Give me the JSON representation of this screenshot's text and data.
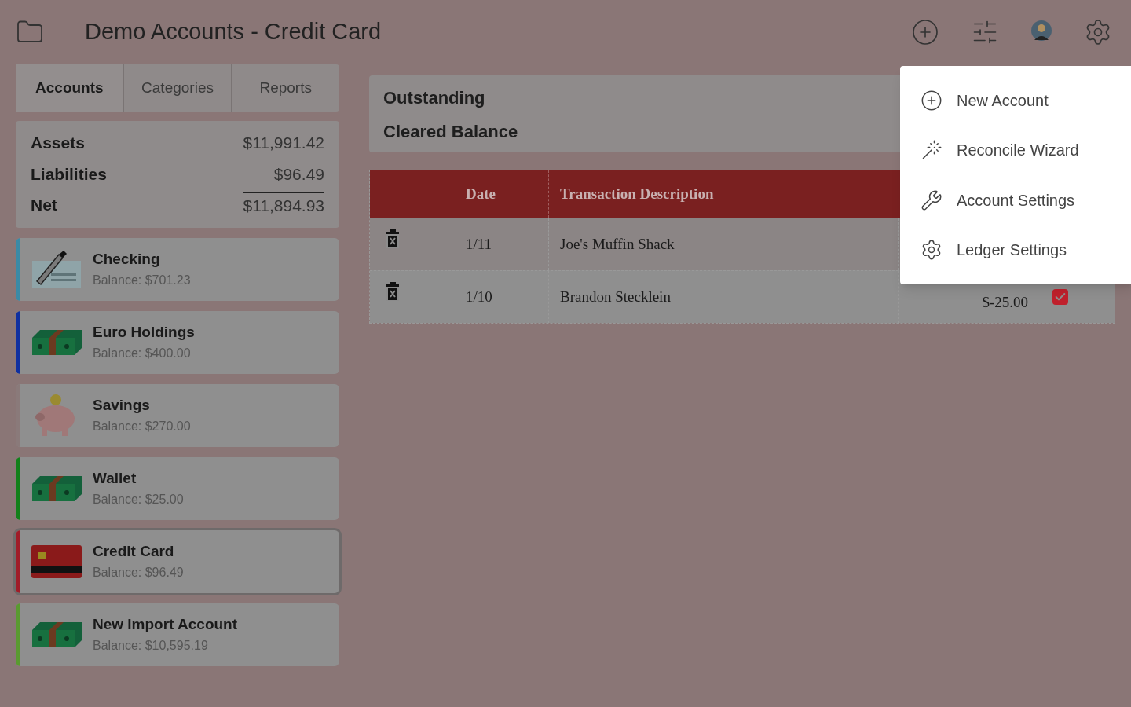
{
  "header": {
    "title": "Demo Accounts - Credit Card"
  },
  "tabs": [
    {
      "label": "Accounts",
      "selected": true
    },
    {
      "label": "Categories",
      "selected": false
    },
    {
      "label": "Reports",
      "selected": false
    }
  ],
  "summary": [
    {
      "kind": "line",
      "label": "Assets",
      "value": "$11,991.42"
    },
    {
      "kind": "line",
      "label": "Liabilities",
      "value": "$96.49"
    },
    {
      "kind": "total",
      "label": "Net",
      "value": "$11,894.93"
    }
  ],
  "accounts": [
    {
      "name": "Checking",
      "balance": "Balance: $701.23",
      "kind": "check",
      "color": "#3a8aa6",
      "selected": false
    },
    {
      "name": "Euro Holdings",
      "balance": "Balance: $400.00",
      "kind": "cash",
      "color": "#1030a0",
      "selected": false
    },
    {
      "name": "Savings",
      "balance": "Balance: $270.00",
      "kind": "piggy",
      "color": "#8a7a7a",
      "selected": false
    },
    {
      "name": "Wallet",
      "balance": "Balance: $25.00",
      "kind": "cash",
      "color": "#12801a",
      "selected": false
    },
    {
      "name": "Credit Card",
      "balance": "Balance: $96.49",
      "kind": "card",
      "color": "#a01c28",
      "selected": true
    },
    {
      "name": "New Import Account",
      "balance": "Balance: $10,595.19",
      "kind": "cash",
      "color": "#5a9a30",
      "selected": false
    }
  ],
  "balances": [
    "Outstanding",
    "Cleared Balance"
  ],
  "table": {
    "columns": [
      "Date",
      "Transaction Description"
    ],
    "rows": [
      {
        "date": "1/11",
        "description": "Joe's Muffin Shack"
      },
      {
        "date": "1/10",
        "description": "Brandon Stecklein",
        "amount": "$-25.00",
        "cleared": true
      }
    ]
  },
  "menu": [
    {
      "label": "New Account",
      "kind": "plus"
    },
    {
      "label": "Reconcile Wizard",
      "kind": "wand"
    },
    {
      "label": "Account Settings",
      "kind": "wrench"
    },
    {
      "label": "Ledger Settings",
      "kind": "gear"
    }
  ]
}
